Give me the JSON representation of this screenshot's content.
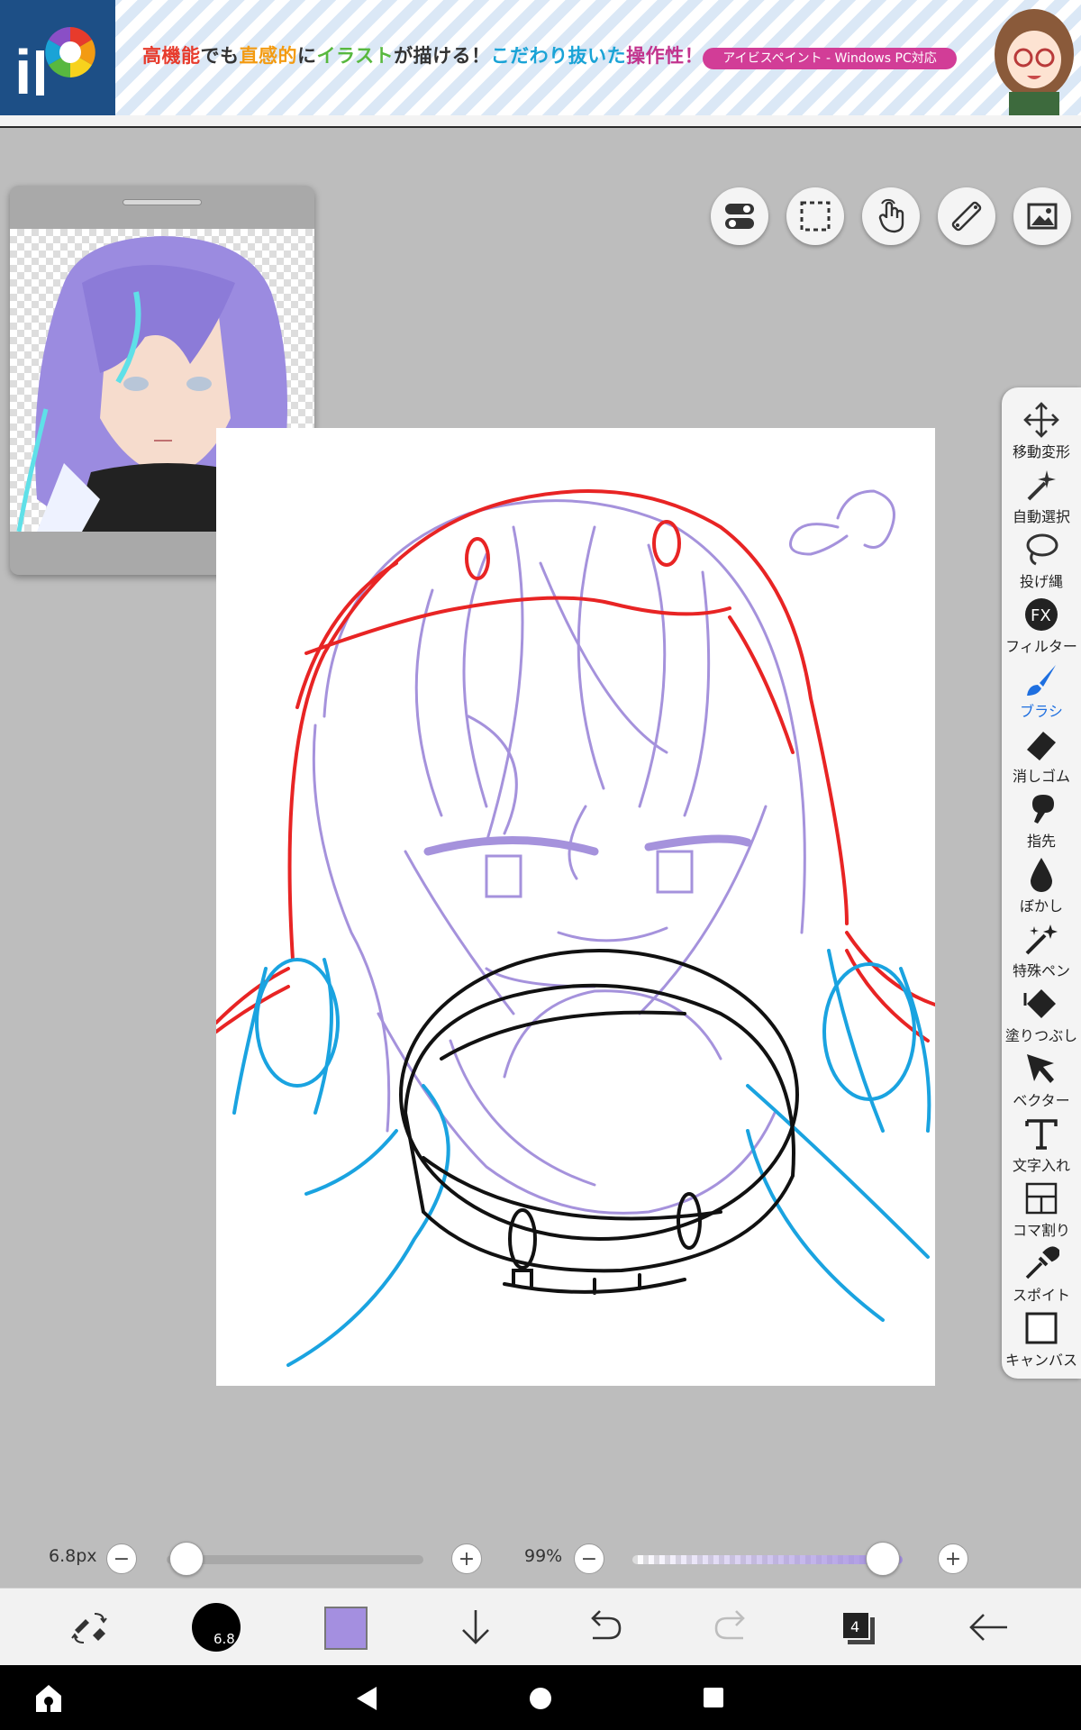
{
  "banner": {
    "segments": [
      {
        "text": "高機能",
        "cls": "c1"
      },
      {
        "text": "でも",
        "cls": "c2"
      },
      {
        "text": "直感的",
        "cls": "c3"
      },
      {
        "text": "に",
        "cls": "c2"
      },
      {
        "text": "イラスト",
        "cls": "c4"
      },
      {
        "text": "が描ける！",
        "cls": "c2"
      },
      {
        "text": "こだわり抜いた",
        "cls": "c5"
      },
      {
        "text": "操作性！",
        "cls": "c6"
      }
    ],
    "pill": "アイビスペイント - Windows PC対応"
  },
  "tools": [
    {
      "label": "移動変形",
      "icon": "move-icon"
    },
    {
      "label": "自動選択",
      "icon": "magic-wand-icon"
    },
    {
      "label": "投げ縄",
      "icon": "lasso-icon"
    },
    {
      "label": "フィルター",
      "icon": "fx-filter-icon"
    },
    {
      "label": "ブラシ",
      "icon": "brush-icon"
    },
    {
      "label": "消しゴム",
      "icon": "eraser-icon"
    },
    {
      "label": "指先",
      "icon": "finger-smudge-icon"
    },
    {
      "label": "ぼかし",
      "icon": "blur-drop-icon"
    },
    {
      "label": "特殊ペン",
      "icon": "special-pen-icon"
    },
    {
      "label": "塗りつぶし",
      "icon": "fill-bucket-icon"
    },
    {
      "label": "ベクター",
      "icon": "vector-arrow-icon"
    },
    {
      "label": "文字入れ",
      "icon": "text-icon"
    },
    {
      "label": "コマ割り",
      "icon": "frame-divider-icon"
    },
    {
      "label": "スポイト",
      "icon": "eyedropper-icon"
    },
    {
      "label": "キャンバス",
      "icon": "canvas-icon"
    }
  ],
  "activeTool": "ブラシ",
  "brush": {
    "size_label": "6.8px",
    "size_value": 6.8,
    "size_fraction": 0.02,
    "size_badge": "6.8"
  },
  "opacity": {
    "label": "99%",
    "value": 99
  },
  "colors": {
    "current": "#a48fe0",
    "accent": "#1e6fe0"
  },
  "layers": {
    "count": "4"
  }
}
